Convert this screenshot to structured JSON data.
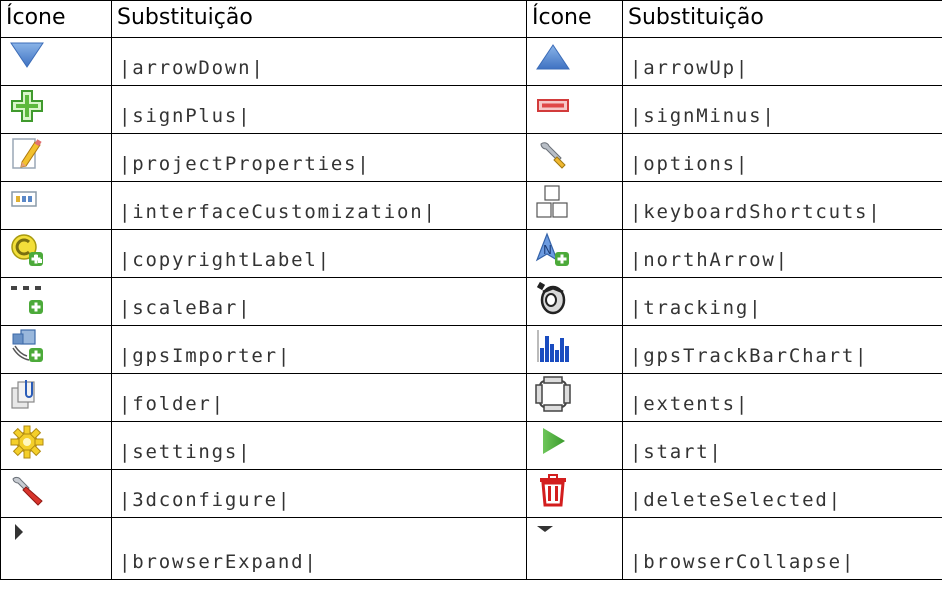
{
  "header": {
    "col1": "Ícone",
    "col2": "Substituição",
    "col3": "Ícone",
    "col4": "Substituição"
  },
  "rows": [
    {
      "left_icon": "arrow-down-icon",
      "left_sub": "|arrowDown|",
      "right_icon": "arrow-up-icon",
      "right_sub": "|arrowUp|"
    },
    {
      "left_icon": "sign-plus-icon",
      "left_sub": "|signPlus|",
      "right_icon": "sign-minus-icon",
      "right_sub": "|signMinus|"
    },
    {
      "left_icon": "project-properties-icon",
      "left_sub": "|projectProperties|",
      "right_icon": "options-wrench-icon",
      "right_sub": "|options|"
    },
    {
      "left_icon": "interface-customization-icon",
      "left_sub": "|interfaceCustomization|",
      "right_icon": "keyboard-shortcuts-icon",
      "right_sub": "|keyboardShortcuts|"
    },
    {
      "left_icon": "copyright-label-icon",
      "left_sub": "|copyrightLabel|",
      "right_icon": "north-arrow-icon",
      "right_sub": "|northArrow|"
    },
    {
      "left_icon": "scale-bar-icon",
      "left_sub": "|scaleBar|",
      "right_icon": "tracking-icon",
      "right_sub": "|tracking|"
    },
    {
      "left_icon": "gps-importer-icon",
      "left_sub": "|gpsImporter|",
      "right_icon": "gps-track-bar-chart-icon",
      "right_sub": "|gpsTrackBarChart|"
    },
    {
      "left_icon": "folder-icon",
      "left_sub": "|folder|",
      "right_icon": "extents-icon",
      "right_sub": "|extents|"
    },
    {
      "left_icon": "settings-gear-icon",
      "left_sub": "|settings|",
      "right_icon": "start-play-icon",
      "right_sub": "|start|"
    },
    {
      "left_icon": "3d-configure-wrench-icon",
      "left_sub": "|3dconfigure|",
      "right_icon": "delete-trash-icon",
      "right_sub": "|deleteSelected|"
    },
    {
      "left_icon": "browser-expand-icon",
      "left_sub": "|browserExpand|",
      "right_icon": "browser-collapse-icon",
      "right_sub": "|browserCollapse|"
    }
  ]
}
